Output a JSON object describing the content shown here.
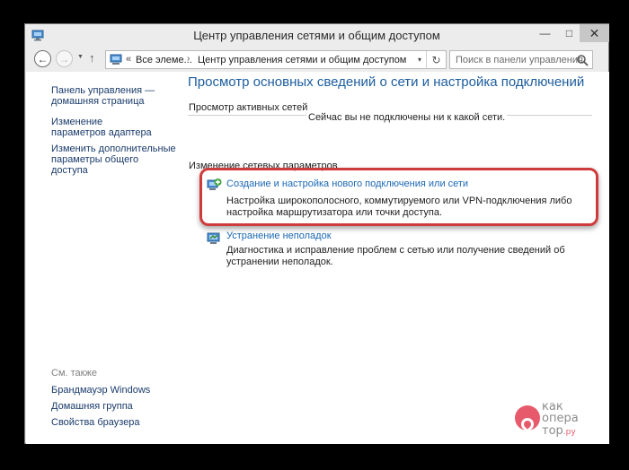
{
  "window": {
    "title": "Центр управления сетями и общим доступом",
    "minimize_icon": "minimize-icon",
    "maximize_icon": "maximize-icon",
    "close_icon": "close-icon"
  },
  "navbar": {
    "back_icon": "arrow-left-icon",
    "forward_icon": "arrow-right-icon",
    "recent_icon": "chevron-down-icon",
    "up_icon": "arrow-up-icon",
    "address": {
      "prefix": "«",
      "segment1": "Все элеме...",
      "separator": "›",
      "segment2": "Центр управления сетями и общим доступом",
      "dropdown": "▾",
      "refresh_icon": "refresh-icon"
    },
    "search": {
      "placeholder": "Поиск в панели управления",
      "icon": "search-icon"
    }
  },
  "sidebar": {
    "links": [
      "Панель управления — домашняя страница",
      "Изменение параметров адаптера",
      "Изменить дополнительные параметры общего доступа"
    ],
    "see_also_label": "См. также",
    "see_also": [
      "Брандмауэр Windows",
      "Домашняя группа",
      "Свойства браузера"
    ]
  },
  "main": {
    "title": "Просмотр основных сведений о сети и настройка подключений",
    "active_networks_label": "Просмотр активных сетей",
    "active_status": "Сейчас вы не подключены ни к какой сети.",
    "change_settings_label": "Изменение сетевых параметров",
    "tasks": [
      {
        "link": "Создание и настройка нового подключения или сети",
        "desc": "Настройка широкополосного, коммутируемого или VPN-подключения либо настройка маршрутизатора или точки доступа."
      },
      {
        "link": "Устранение неполадок",
        "desc": "Диагностика и исправление проблем с сетью или получение сведений об устранении неполадок."
      }
    ]
  },
  "watermark": {
    "line1": "как",
    "line2": "опера",
    "line3": "тор",
    "suffix": ".ру",
    "accent_color": "#e65a6b"
  },
  "colors": {
    "link": "#1b68b3",
    "title": "#1c5d9f",
    "highlight": "#cf3b3b"
  }
}
